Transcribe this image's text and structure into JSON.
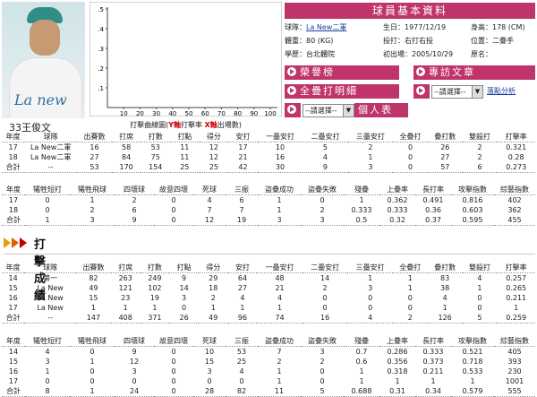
{
  "player": {
    "number_name": "33王俊文",
    "jersey_text": "La new"
  },
  "chart": {
    "caption_prefix": "打擊曲線圖(",
    "caption_y": "Y軸",
    "caption_mid": "打擊率 ",
    "caption_x": "X軸",
    "caption_suffix": "出場數)",
    "y_ticks": [
      ".1",
      ".2",
      ".3",
      ".4",
      ".5"
    ],
    "x_ticks": [
      "10",
      "20",
      "30",
      "40",
      "50",
      "60",
      "70",
      "80",
      "90",
      "100"
    ]
  },
  "chart_data": {
    "type": "line",
    "x": [],
    "series": [],
    "ylim": [
      0,
      0.5
    ],
    "xlim": [
      0,
      100
    ],
    "y_ticks": [
      0.1,
      0.2,
      0.3,
      0.4,
      0.5
    ],
    "x_ticks": [
      10,
      20,
      30,
      40,
      50,
      60,
      70,
      80,
      90,
      100
    ],
    "grid": false
  },
  "info": {
    "title": "球員基本資料",
    "team_label": "球隊：",
    "team": "La New二軍",
    "birth": "生日：1977/12/19",
    "height": "身高：178 (CM)",
    "weight": "體重：80 (KG)",
    "bats": "投打：右打右投",
    "position": "位置：二疊手",
    "school": "學歷：台北體院",
    "debut": "初出場：2005/10/29",
    "original": "原名："
  },
  "buttons": {
    "honor": "榮譽榜",
    "interview": "專訪文章",
    "detail": "全疊打明細",
    "personal": "個人表",
    "select1": "--請選擇--",
    "select2": "--請選擇--",
    "fielding": "落點分析"
  },
  "table1": {
    "headers": [
      "年度",
      "球隊",
      "出賽數",
      "打席",
      "打數",
      "打點",
      "得分",
      "安打",
      "一壘安打",
      "二壘安打",
      "三壘安打",
      "全疊打",
      "疊打數",
      "雙殺打",
      "打擊率"
    ],
    "rows": [
      [
        "17",
        "La New二軍",
        "16",
        "58",
        "53",
        "11",
        "12",
        "17",
        "10",
        "5",
        "2",
        "0",
        "26",
        "2",
        "0.321"
      ],
      [
        "18",
        "La New二軍",
        "27",
        "84",
        "75",
        "11",
        "12",
        "21",
        "16",
        "4",
        "1",
        "0",
        "27",
        "2",
        "0.28"
      ],
      [
        "合計",
        "--",
        "53",
        "170",
        "154",
        "25",
        "25",
        "42",
        "30",
        "9",
        "3",
        "0",
        "57",
        "6",
        "0.273"
      ]
    ]
  },
  "table2": {
    "headers": [
      "年度",
      "犧牲短打",
      "犧牲飛球",
      "四壞球",
      "故意四壞",
      "死球",
      "三振",
      "盜疊成功",
      "盜疊失敗",
      "殘疊",
      "上疊率",
      "長打率",
      "攻擊指數",
      "綜藝指數"
    ],
    "rows": [
      [
        "17",
        "0",
        "1",
        "2",
        "0",
        "4",
        "6",
        "1",
        "0",
        "1",
        "0.362",
        "0.491",
        "0.816",
        "402"
      ],
      [
        "18",
        "0",
        "2",
        "6",
        "0",
        "7",
        "7",
        "1",
        "2",
        "0.333",
        "0.333",
        "0.36",
        "0.603",
        "362"
      ],
      [
        "合計",
        "1",
        "3",
        "9",
        "0",
        "12",
        "19",
        "3",
        "3",
        "0.5",
        "0.32",
        "0.37",
        "0.595",
        "455"
      ]
    ]
  },
  "section": {
    "title": "打擊成績"
  },
  "table3": {
    "headers": [
      "年度",
      "球隊",
      "出賽數",
      "打席",
      "打數",
      "打點",
      "得分",
      "安打",
      "一壘安打",
      "二壘安打",
      "三壘安打",
      "全疊打",
      "疊打數",
      "雙殺打",
      "打擊率"
    ],
    "rows": [
      [
        "14",
        "第一",
        "82",
        "263",
        "249",
        "9",
        "29",
        "64",
        "48",
        "14",
        "1",
        "1",
        "83",
        "4",
        "0.257"
      ],
      [
        "15",
        "La New",
        "49",
        "121",
        "102",
        "14",
        "18",
        "27",
        "21",
        "2",
        "3",
        "1",
        "38",
        "1",
        "0.265"
      ],
      [
        "16",
        "La New",
        "15",
        "23",
        "19",
        "3",
        "2",
        "4",
        "4",
        "0",
        "0",
        "0",
        "4",
        "0",
        "0.211"
      ],
      [
        "17",
        "La New",
        "1",
        "1",
        "1",
        "0",
        "1",
        "1",
        "1",
        "0",
        "0",
        "0",
        "1",
        "0",
        "1"
      ],
      [
        "合計",
        "--",
        "147",
        "408",
        "371",
        "26",
        "49",
        "96",
        "74",
        "16",
        "4",
        "2",
        "126",
        "5",
        "0.259"
      ]
    ]
  },
  "table4": {
    "headers": [
      "年度",
      "犧牲短打",
      "犧牲飛球",
      "四壞球",
      "故意四壞",
      "死球",
      "三振",
      "盜疊成功",
      "盜疊失敗",
      "殘疊",
      "上疊率",
      "長打率",
      "攻擊指數",
      "綜藝指數"
    ],
    "rows": [
      [
        "14",
        "4",
        "0",
        "9",
        "0",
        "10",
        "53",
        "7",
        "3",
        "0.7",
        "0.286",
        "0.333",
        "0.521",
        "405"
      ],
      [
        "15",
        "3",
        "1",
        "12",
        "0",
        "15",
        "25",
        "2",
        "2",
        "0.6",
        "0.356",
        "0.373",
        "0.718",
        "393"
      ],
      [
        "16",
        "1",
        "0",
        "3",
        "0",
        "3",
        "4",
        "1",
        "0",
        "1",
        "0.318",
        "0.211",
        "0.533",
        "230"
      ],
      [
        "17",
        "0",
        "0",
        "0",
        "0",
        "0",
        "0",
        "1",
        "0",
        "1",
        "1",
        "1",
        "1",
        "1001"
      ],
      [
        "合計",
        "8",
        "1",
        "24",
        "0",
        "28",
        "82",
        "11",
        "5",
        "0.688",
        "0.31",
        "0.34",
        "0.579",
        "555"
      ]
    ]
  }
}
